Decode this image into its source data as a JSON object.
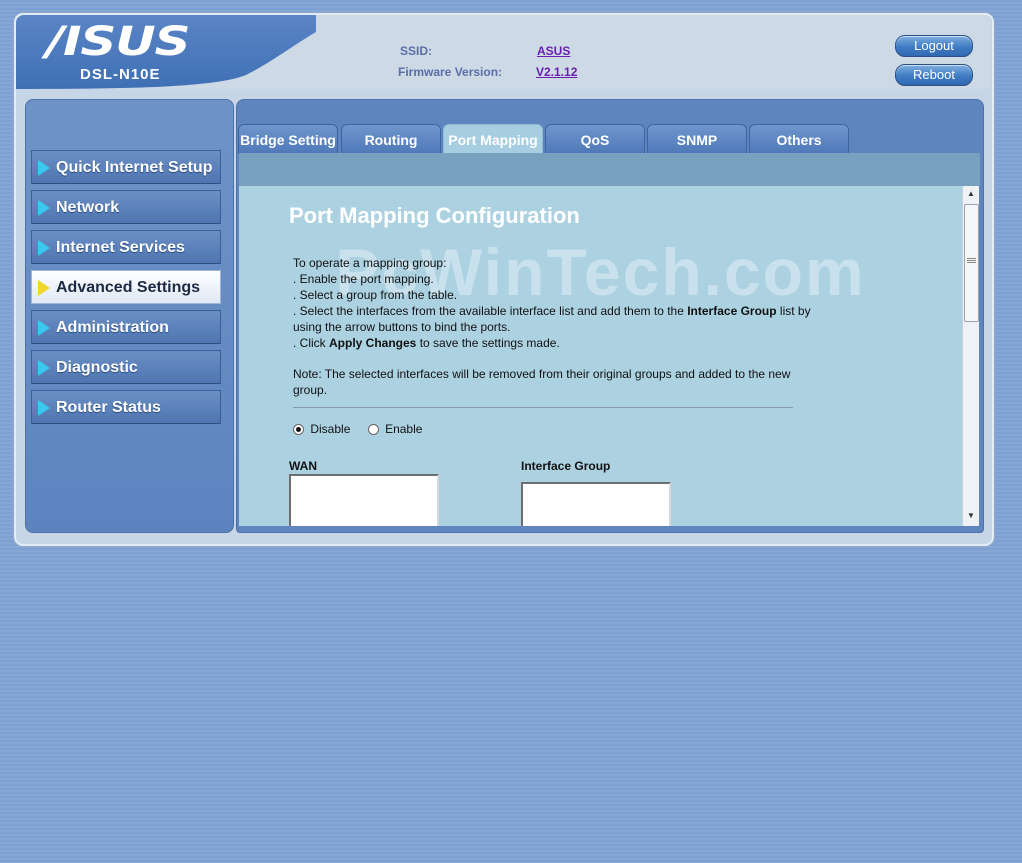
{
  "brand": {
    "logo": "/ISUS",
    "model": "DSL-N10E"
  },
  "info": {
    "ssid_label": "SSID:",
    "ssid_value": "ASUS",
    "firmware_label": "Firmware Version:",
    "firmware_value": "V2.1.12"
  },
  "header_buttons": {
    "logout": "Logout",
    "reboot": "Reboot"
  },
  "sidebar": {
    "items": [
      {
        "label": "Quick Internet Setup"
      },
      {
        "label": "Network"
      },
      {
        "label": "Internet Services"
      },
      {
        "label": "Advanced Settings"
      },
      {
        "label": "Administration"
      },
      {
        "label": "Diagnostic"
      },
      {
        "label": "Router Status"
      }
    ]
  },
  "tabs": [
    {
      "label": "Bridge Setting"
    },
    {
      "label": "Routing"
    },
    {
      "label": "Port Mapping"
    },
    {
      "label": "QoS"
    },
    {
      "label": "SNMP"
    },
    {
      "label": "Others"
    }
  ],
  "panel": {
    "watermark": "PcWinTech.com",
    "title": "Port Mapping Configuration",
    "intro": "To operate a mapping group:",
    "step1": ". Enable the port mapping.",
    "step2": ". Select a group from the table.",
    "step3_a": ". Select the interfaces from the available interface list and add them to the ",
    "step3_b": "Interface Group",
    "step3_c": " list by using the arrow buttons to bind the ports.",
    "step4_a": ". Click ",
    "step4_b": "Apply Changes",
    "step4_c": " to save the settings made.",
    "note": "Note: The selected interfaces will be removed from their original groups and added to the new group.",
    "radio_disable": "Disable",
    "radio_enable": "Enable",
    "wan_label": "WAN",
    "group_label": "Interface Group"
  },
  "colors": {
    "accent": "#5f85bf",
    "panel_bg": "#acd2e2",
    "active_arrow": "#f2d62a",
    "arrow": "#39c8f0"
  }
}
